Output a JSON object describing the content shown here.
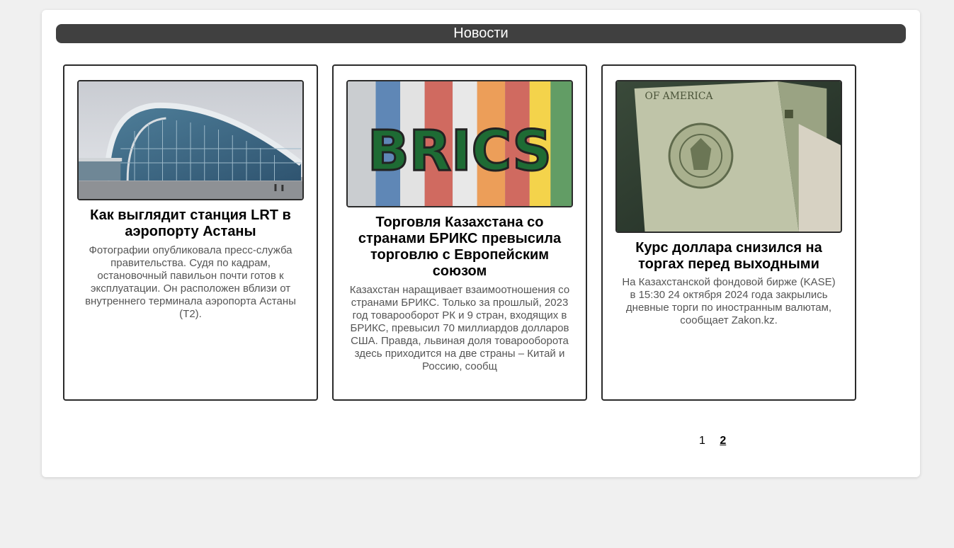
{
  "header": {
    "title": "Новости"
  },
  "news": [
    {
      "title": "Как выглядит станция LRT в аэропорту Астаны",
      "description": "Фотографии опубликовала пресс-служба правительства. Судя по кадрам, остановочный павильон почти готов к эксплуатации. Он расположен вблизи от внутреннего терминала аэропорта Астаны (Т2)."
    },
    {
      "title": "Торговля Казахстана со странами БРИКС превысила торговлю с Европейским союзом",
      "description": "Казахстан наращивает взаимоотношения со странами БРИКС. Только за прошлый, 2023 год товарооборот РК и 9 стран, входящих в БРИКС, превысил 70 миллиардов долларов США. Правда, львиная доля товарооборота здесь приходится на две страны – Китай и Россию, сообщ",
      "image_text": "BRICS"
    },
    {
      "title": "Курс доллара снизился на торгах перед выходными",
      "description": "На Казахстанской фондовой бирже (KASE) в 15:30 24 октября 2024 года закрылись дневные торги по иностранным валютам, сообщает Zakon.kz.",
      "image_text": "OF AMERICA"
    }
  ],
  "pagination": {
    "pages": [
      "1",
      "2"
    ],
    "current": "2"
  }
}
